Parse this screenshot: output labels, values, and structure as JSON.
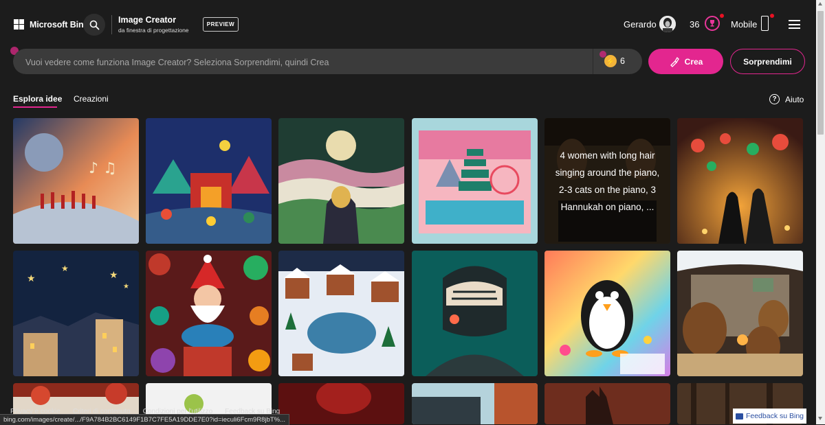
{
  "header": {
    "brand": "Microsoft Bing",
    "app_title": "Image Creator",
    "app_subtitle": "da finestra di progettazione",
    "preview_badge": "PREVIEW",
    "user_name": "Gerardo",
    "rewards_count": "36",
    "mobile_label": "Mobile"
  },
  "prompt": {
    "placeholder": "Vuoi vedere come funziona Image Creator? Seleziona Sorprendimi, quindi Crea",
    "boosts": "6",
    "create_label": "Crea",
    "surprise_label": "Sorprendimi"
  },
  "tabs": {
    "explore": "Esplora idee",
    "creations": "Creazioni",
    "help": "Aiuto"
  },
  "gallery": {
    "overlay_text": "4 women with long hair singing around the piano, 2-3 cats on the piano, 3 Hannukah on piano, ..."
  },
  "footer": {
    "links": [
      "Privacy e cookie",
      "Criteri di contenuto",
      "Condizioni per l'utilizzo",
      "Feedback su Bing"
    ],
    "status_url": "bing.com/images/create/.../F9A784B2BC6149F1B7C7FE5A19DDE7E0?id=ieculi6Fcm9R8jbT%...",
    "feedback_button": "Feedback su Bing"
  },
  "colors": {
    "background": "#1c1c1c",
    "accent": "#e3268f",
    "prompt_bar": "#3b3b3b"
  }
}
